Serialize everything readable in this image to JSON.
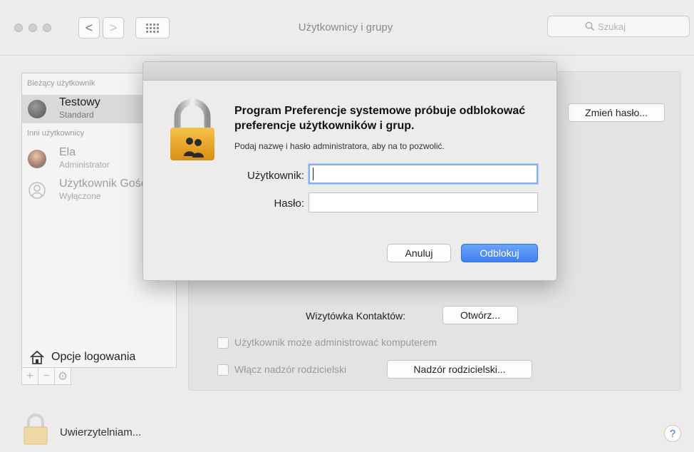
{
  "window": {
    "title": "Użytkownicy i grupy",
    "back_glyph": "<",
    "forward_glyph": ">",
    "search_placeholder": "Szukaj",
    "search_icon": "search-icon"
  },
  "sidebar": {
    "current_user_header": "Bieżący użytkownik",
    "other_users_header": "Inni użytkownicy",
    "users": [
      {
        "name": "Testowy",
        "role": "Standard",
        "selected": true
      },
      {
        "name": "Ela",
        "role": "Administrator",
        "selected": false
      },
      {
        "name": "Użytkownik Gość",
        "role": "Wyłączone",
        "selected": false
      }
    ],
    "login_options": "Opcje logowania",
    "add_glyph": "+",
    "remove_glyph": "−",
    "gear_glyph": "⚙"
  },
  "main": {
    "change_password": "Zmień hasło...",
    "contact_card_label": "Wizytówka Kontaktów:",
    "open_button": "Otwórz...",
    "admin_checkbox": "Użytkownik może administrować komputerem",
    "parental_checkbox": "Włącz nadzór rodzicielski",
    "parental_button": "Nadzór rodzicielski..."
  },
  "footer": {
    "auth_status": "Uwierzytelniam...",
    "help_glyph": "?"
  },
  "dialog": {
    "title": "Program Preferencje systemowe próbuje odblokować preferencje użytkowników i grup.",
    "subtitle": "Podaj nazwę i hasło administratora, aby na to pozwolić.",
    "username_label": "Użytkownik:",
    "username_value": "",
    "password_label": "Hasło:",
    "password_value": "",
    "cancel": "Anuluj",
    "unlock": "Odblokuj"
  },
  "colors": {
    "accent": "#3e82f2",
    "lock_gold": "#e9a92a",
    "window_bg": "#ececec"
  }
}
